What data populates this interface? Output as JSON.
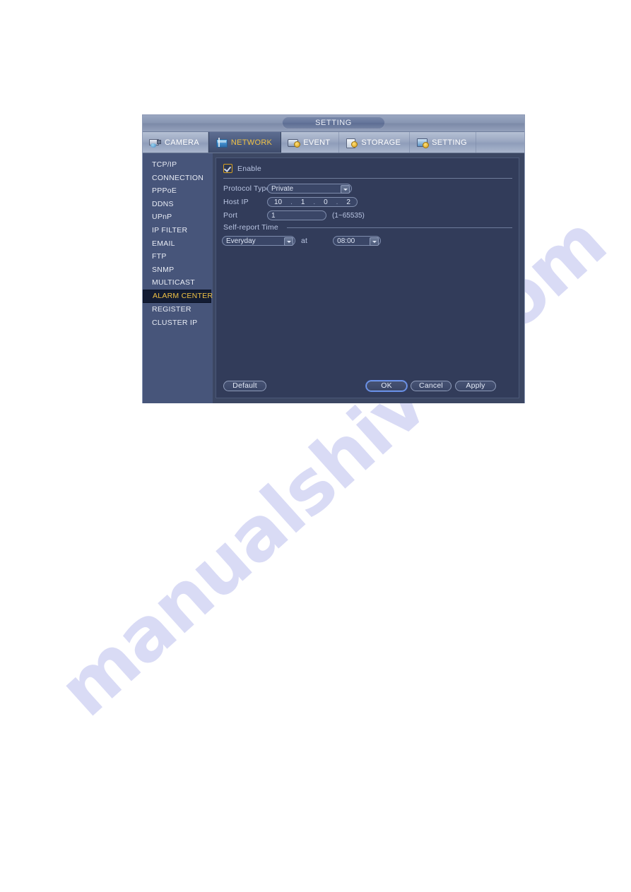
{
  "watermark": {
    "text": "manualshive.com"
  },
  "window": {
    "title": "SETTING",
    "tabs": [
      {
        "label": "CAMERA",
        "icon": "camera-icon",
        "active": false
      },
      {
        "label": "NETWORK",
        "icon": "network-icon",
        "active": true
      },
      {
        "label": "EVENT",
        "icon": "event-icon",
        "active": false
      },
      {
        "label": "STORAGE",
        "icon": "storage-icon",
        "active": false
      },
      {
        "label": "SETTING",
        "icon": "system-icon",
        "active": false
      }
    ],
    "sidebar": {
      "items": [
        {
          "label": "TCP/IP",
          "active": false
        },
        {
          "label": "CONNECTION",
          "active": false
        },
        {
          "label": "PPPoE",
          "active": false
        },
        {
          "label": "DDNS",
          "active": false
        },
        {
          "label": "UPnP",
          "active": false
        },
        {
          "label": "IP FILTER",
          "active": false
        },
        {
          "label": "EMAIL",
          "active": false
        },
        {
          "label": "FTP",
          "active": false
        },
        {
          "label": "SNMP",
          "active": false
        },
        {
          "label": "MULTICAST",
          "active": false
        },
        {
          "label": "ALARM CENTER",
          "active": true
        },
        {
          "label": "REGISTER",
          "active": false
        },
        {
          "label": "CLUSTER IP",
          "active": false
        }
      ]
    },
    "form": {
      "enable_label": "Enable",
      "enable_checked": true,
      "protocol_label": "Protocol Type",
      "protocol_value": "Private",
      "host_ip_label": "Host IP",
      "host_ip": {
        "o1": "10",
        "o2": "1",
        "o3": "0",
        "o4": "2",
        "sep": "."
      },
      "port_label": "Port",
      "port_value": "1",
      "port_hint": "(1~65535)",
      "self_report_label": "Self-report Time",
      "day_value": "Everyday",
      "at_label": "at",
      "time_value": "08:00"
    },
    "buttons": {
      "default": "Default",
      "ok": "OK",
      "cancel": "Cancel",
      "apply": "Apply"
    },
    "colors": {
      "accent_gold": "#f0c245",
      "panel_bg": "#323c5a",
      "sidebar_bg": "#47557a",
      "active_item_bg": "#131c33"
    }
  }
}
